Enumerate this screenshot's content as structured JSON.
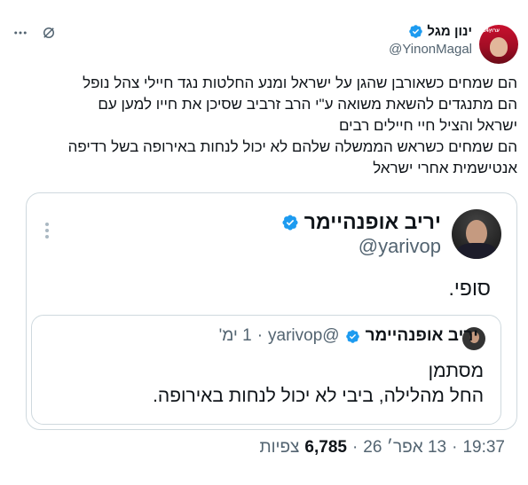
{
  "tweet": {
    "author": "ינון מגל",
    "handle": "@YinonMagal",
    "avatar_tag": "ערוץ14",
    "lines": [
      "הם שמחים כשאורבן שהגן על ישראל ומנע החלטות נגד חיילי צהל נופל",
      "הם מתנגדים להשאת משואה ע\"י הרב זרביב שסיכן את חייו למען עם",
      "ישראל והציל חיי חיילים רבים",
      "הם שמחים כשראש הממשלה שלהם לא יכול לנחות באירופה בשל רדיפה",
      "אנטישמית אחרי ישראל"
    ]
  },
  "quote": {
    "author": "יריב אופנהיימר",
    "handle": "@yarivop",
    "text": "סופי."
  },
  "inner_quote": {
    "author": "יריב אופנהיימר",
    "handle": "@yarivop",
    "sep": "·",
    "time": "1 ימ'",
    "lines": [
      "מסתמן",
      "החל מהלילה, ביבי לא יכול לנחות באירופה."
    ]
  },
  "footer": {
    "time": "19:37",
    "sep1": "·",
    "date": "13 אפר׳ 26",
    "sep2": "·",
    "views_count": "6,785",
    "views_label": "צפיות"
  },
  "icons": {
    "more": "more-icon",
    "grok": "grok-icon",
    "verified": "verified-badge-icon",
    "accent": "#1d9bf0"
  }
}
